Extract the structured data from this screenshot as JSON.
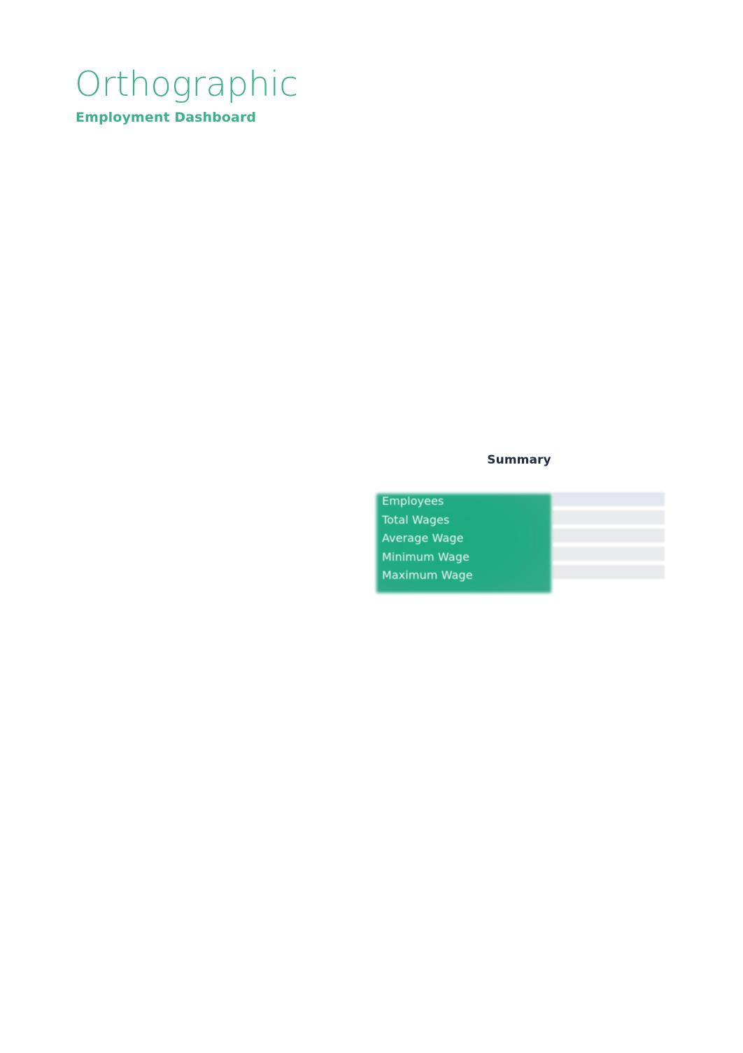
{
  "header": {
    "app_title": "Orthographic",
    "subtitle": "Employment Dashboard",
    "brand_color": "#3faf8a"
  },
  "summary": {
    "heading": "Summary",
    "heading_color": "#1f2a44",
    "label_column_color": "#23ab82",
    "value_column_color": "#e9eaec",
    "rows": [
      {
        "label": "Employees",
        "value": ""
      },
      {
        "label": "Total Wages",
        "value": ""
      },
      {
        "label": "Average Wage",
        "value": ""
      },
      {
        "label": "Minimum Wage",
        "value": ""
      },
      {
        "label": "Maximum Wage",
        "value": ""
      }
    ]
  }
}
